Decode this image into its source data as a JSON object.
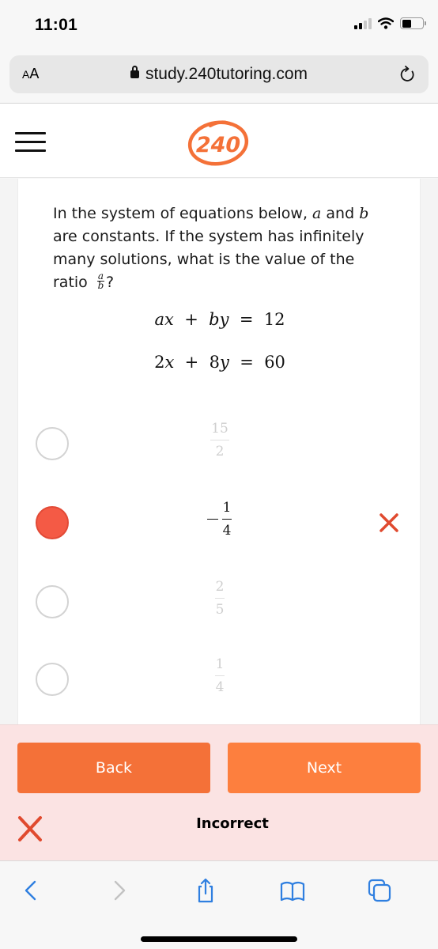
{
  "status_bar": {
    "time": "11:01",
    "signal_bars": 2,
    "signal_total": 4,
    "battery_percent": 45
  },
  "browser": {
    "text_size_label_small": "A",
    "text_size_label_large": "A",
    "url": "study.240tutoring.com",
    "icons": [
      "lock-icon",
      "reload-icon"
    ]
  },
  "site_header": {
    "menu_icon": "hamburger-icon",
    "logo_text": "240",
    "brand_color": "#f47138"
  },
  "question": {
    "text_part1": "In the system of equations below, ",
    "var_a": "a",
    "text_and": " and ",
    "var_b": "b",
    "text_part2": " are constants. If the system has infinitely many solutions, what is the value of the ratio ",
    "ratio_num": "a",
    "ratio_den": "b",
    "text_end": "?",
    "equations": [
      {
        "lhs1_coef": "a",
        "lhs1_var": "x",
        "op": "+",
        "lhs2_coef": "b",
        "lhs2_var": "y",
        "eq": "=",
        "rhs": "12"
      },
      {
        "lhs1_coef": "2",
        "lhs1_var": "x",
        "op": "+",
        "lhs2_coef": "8",
        "lhs2_var": "y",
        "eq": "=",
        "rhs": "60"
      }
    ]
  },
  "choices": [
    {
      "negative": false,
      "numerator": "15",
      "denominator": "2",
      "selected": false,
      "state": "faded"
    },
    {
      "negative": true,
      "numerator": "1",
      "denominator": "4",
      "selected": true,
      "state": "incorrect"
    },
    {
      "negative": false,
      "numerator": "2",
      "denominator": "5",
      "selected": false,
      "state": "faded"
    },
    {
      "negative": false,
      "numerator": "1",
      "denominator": "4",
      "selected": false,
      "state": "faded"
    }
  ],
  "feedback": {
    "back_label": "Back",
    "next_label": "Next",
    "result_text": "Incorrect",
    "result_icon": "x-icon",
    "error_color": "#e04a2f",
    "background": "#fbe3e3"
  },
  "toolbar": {
    "items": [
      "back-icon",
      "forward-icon",
      "share-icon",
      "bookmarks-icon",
      "tabs-icon"
    ],
    "accent": "#2f7fe0"
  }
}
